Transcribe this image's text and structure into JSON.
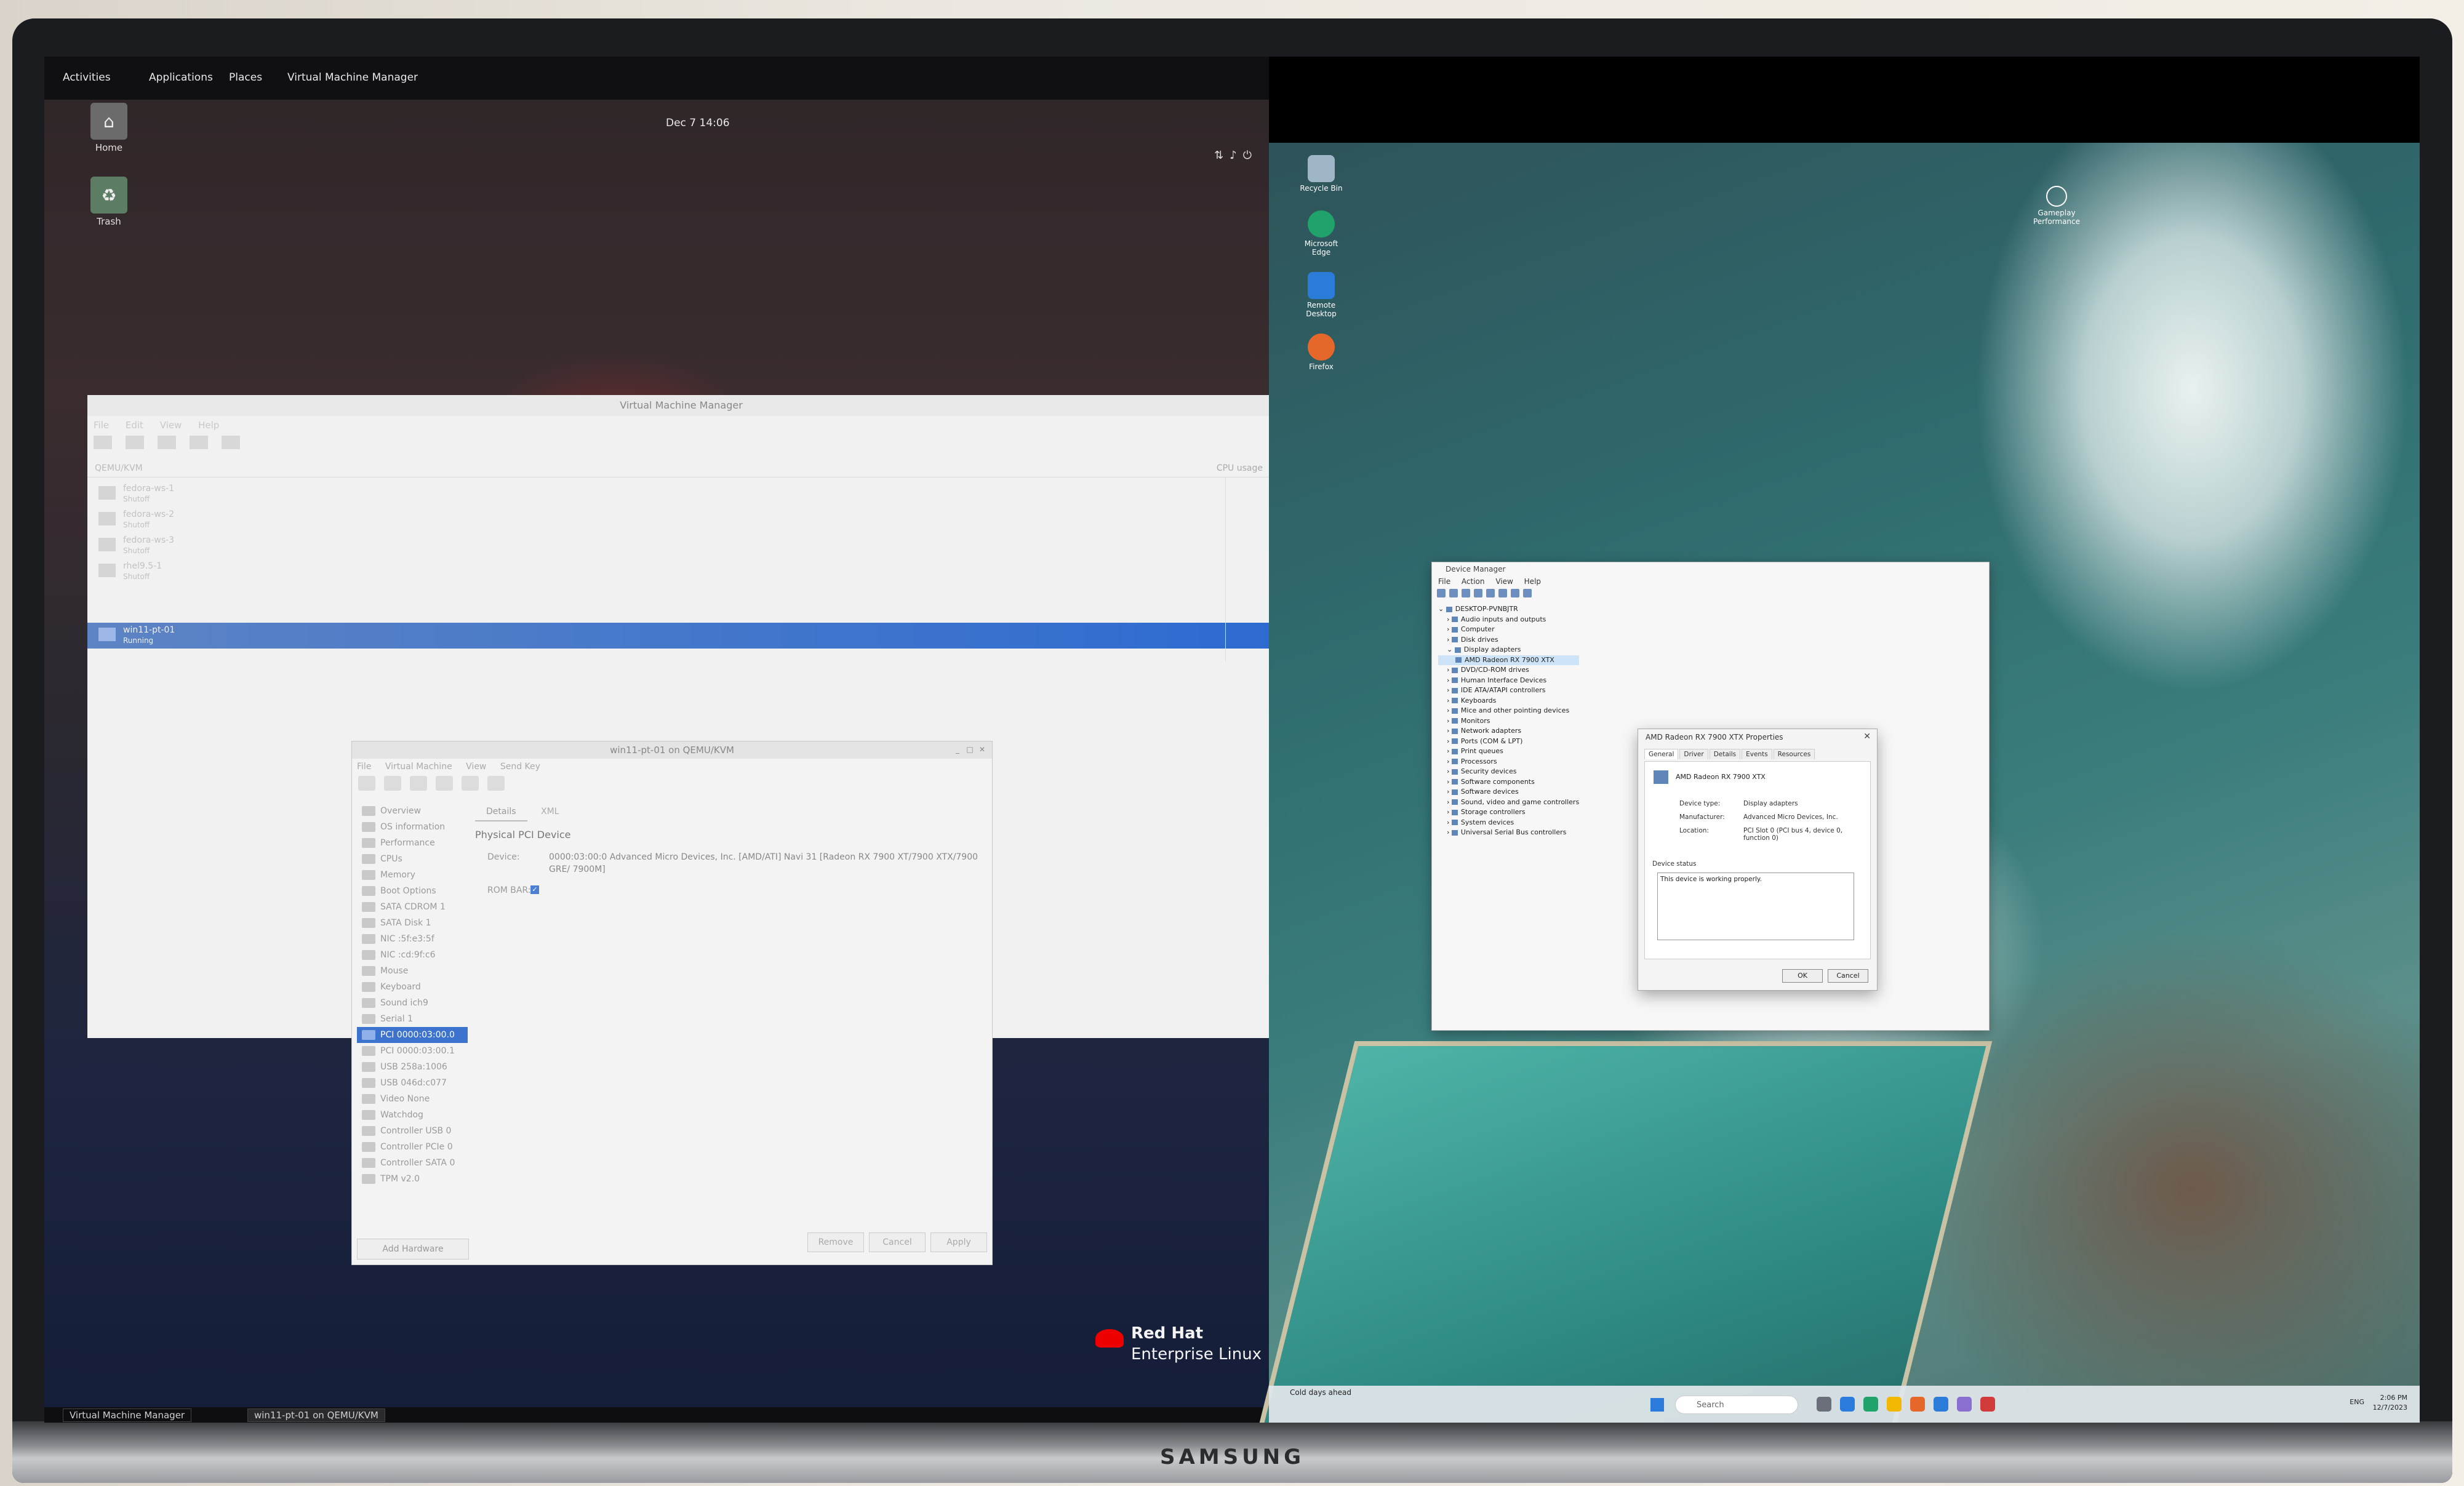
{
  "monitor": {
    "brand": "SAMSUNG"
  },
  "gnome": {
    "topbar": {
      "activities": "Activities",
      "applications": "Applications",
      "places": "Places",
      "app_name": "Virtual Machine Manager",
      "clock": "Dec 7  14:06"
    },
    "desktop_icons": [
      {
        "label": "Home",
        "icon": "home-folder-icon"
      },
      {
        "label": "Trash",
        "icon": "trash-icon"
      }
    ],
    "sys_icons": [
      "network-icon",
      "volume-icon",
      "power-icon"
    ]
  },
  "vmm": {
    "title": "Virtual Machine Manager",
    "menu": [
      "File",
      "Edit",
      "View",
      "Help"
    ],
    "list_header": "QEMU/KVM",
    "cpu_column": "CPU usage",
    "vms": [
      {
        "name": "fedora-ws-1",
        "state": "Shutoff"
      },
      {
        "name": "fedora-ws-2",
        "state": "Shutoff"
      },
      {
        "name": "fedora-ws-3",
        "state": "Shutoff"
      },
      {
        "name": "rhel9.5-1",
        "state": "Shutoff"
      },
      {
        "name": "win11-pt-01",
        "state": "Running",
        "selected": true
      }
    ]
  },
  "vmdetails": {
    "title": "win11-pt-01 on QEMU/KVM",
    "menu": [
      "File",
      "Virtual Machine",
      "View",
      "Send Key"
    ],
    "sidebar": [
      "Overview",
      "OS information",
      "Performance",
      "CPUs",
      "Memory",
      "Boot Options",
      "SATA CDROM 1",
      "SATA Disk 1",
      "NIC :5f:e3:5f",
      "NIC :cd:9f:c6",
      "Mouse",
      "Keyboard",
      "Sound ich9",
      "Serial 1",
      "PCI 0000:03:00.0",
      "PCI 0000:03:00.1",
      "USB 258a:1006",
      "USB 046d:c077",
      "Video None",
      "Watchdog",
      "Controller USB 0",
      "Controller PCIe 0",
      "Controller SATA 0",
      "TPM v2.0"
    ],
    "selected_index": 14,
    "add_hardware": "Add Hardware",
    "tabs": [
      "Details",
      "XML"
    ],
    "section": "Physical PCI Device",
    "device_label": "Device:",
    "device_value": "0000:03:00:0 Advanced Micro Devices, Inc. [AMD/ATI] Navi 31 [Radeon RX 7900 XT/7900 XTX/7900 GRE/ 7900M]",
    "rombar_label": "ROM BAR:",
    "buttons": {
      "remove": "Remove",
      "cancel": "Cancel",
      "apply": "Apply"
    }
  },
  "rhel_logo": {
    "line1": "Red Hat",
    "line2": "Enterprise Linux"
  },
  "gnome_taskbar": [
    {
      "label": "Virtual Machine Manager"
    },
    {
      "label": "win11-pt-01 on QEMU/KVM"
    }
  ],
  "windows": {
    "desktop_icons": [
      {
        "label": "Recycle Bin",
        "color": "#9fb6c9"
      },
      {
        "label": "Microsoft Edge",
        "color": "#1fa36b"
      },
      {
        "label": "Remote Desktop",
        "color": "#2b7bd8"
      },
      {
        "label": "Firefox",
        "color": "#e5682a"
      }
    ],
    "corner_icon": "Gameplay Performance",
    "device_manager": {
      "title": "Device Manager",
      "menu": [
        "File",
        "Action",
        "View",
        "Help"
      ],
      "tree": [
        {
          "label": "DESKTOP-PVNBJTR",
          "level": 0
        },
        {
          "label": "Audio inputs and outputs",
          "level": 1
        },
        {
          "label": "Computer",
          "level": 1
        },
        {
          "label": "Disk drives",
          "level": 1
        },
        {
          "label": "Display adapters",
          "level": 1
        },
        {
          "label": "AMD Radeon RX 7900 XTX",
          "level": 2,
          "selected": true
        },
        {
          "label": "DVD/CD-ROM drives",
          "level": 1
        },
        {
          "label": "Human Interface Devices",
          "level": 1
        },
        {
          "label": "IDE ATA/ATAPI controllers",
          "level": 1
        },
        {
          "label": "Keyboards",
          "level": 1
        },
        {
          "label": "Mice and other pointing devices",
          "level": 1
        },
        {
          "label": "Monitors",
          "level": 1
        },
        {
          "label": "Network adapters",
          "level": 1
        },
        {
          "label": "Ports (COM & LPT)",
          "level": 1
        },
        {
          "label": "Print queues",
          "level": 1
        },
        {
          "label": "Processors",
          "level": 1
        },
        {
          "label": "Security devices",
          "level": 1
        },
        {
          "label": "Software components",
          "level": 1
        },
        {
          "label": "Software devices",
          "level": 1
        },
        {
          "label": "Sound, video and game controllers",
          "level": 1
        },
        {
          "label": "Storage controllers",
          "level": 1
        },
        {
          "label": "System devices",
          "level": 1
        },
        {
          "label": "Universal Serial Bus controllers",
          "level": 1
        }
      ]
    },
    "properties": {
      "title": "AMD Radeon RX 7900 XTX Properties",
      "tabs": [
        "General",
        "Driver",
        "Details",
        "Events",
        "Resources"
      ],
      "device_name": "AMD Radeon RX 7900 XTX",
      "rows": [
        {
          "k": "Device type:",
          "v": "Display adapters"
        },
        {
          "k": "Manufacturer:",
          "v": "Advanced Micro Devices, Inc."
        },
        {
          "k": "Location:",
          "v": "PCI Slot 0 (PCI bus 4, device 0, function 0)"
        }
      ],
      "status_group": "Device status",
      "status_text": "This device is working properly.",
      "ok": "OK",
      "cancel": "Cancel"
    },
    "taskbar": {
      "weather": "Cold days ahead",
      "search": "Search",
      "tray_lang": "ENG",
      "clock_time": "2:06 PM",
      "clock_date": "12/7/2023",
      "pinned_colors": [
        "#6a6f7a",
        "#2a7bdc",
        "#1fa36b",
        "#f2b700",
        "#e5682a",
        "#2b7bd8",
        "#8a6fd1",
        "#d23b3b"
      ]
    }
  }
}
